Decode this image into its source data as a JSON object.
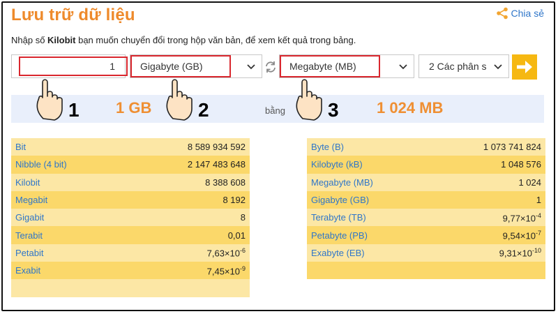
{
  "title": "Lưu trữ dữ liệu",
  "share_label": "Chia sẻ",
  "instruction": {
    "before": "Nhập số ",
    "bold": "Kilobit",
    "after": " bạn muốn chuyển đổi trong hộp văn bản, để xem kết quả trong bảng."
  },
  "input_value": "1",
  "from_unit": "Gigabyte (GB)",
  "to_unit": "Megabyte (MB)",
  "precision": "2 Các phân s",
  "result": {
    "from": "1 GB",
    "word": "bằng",
    "to": "1 024 MB"
  },
  "steps": [
    "1",
    "2",
    "3"
  ],
  "left_table": [
    {
      "unit": "Bit",
      "value": "8 589 934 592"
    },
    {
      "unit": "Nibble (4 bit)",
      "value": "2 147 483 648"
    },
    {
      "unit": "Kilobit",
      "value": "8 388 608"
    },
    {
      "unit": "Megabit",
      "value": "8 192"
    },
    {
      "unit": "Gigabit",
      "value": "8"
    },
    {
      "unit": "Terabit",
      "value": "0,01"
    },
    {
      "unit": "Petabit",
      "value": "7,63×10",
      "exp": "-6"
    },
    {
      "unit": "Exabit",
      "value": "7,45×10",
      "exp": "-9"
    },
    {
      "unit": "",
      "value": ""
    }
  ],
  "right_table": [
    {
      "unit": "Byte (B)",
      "value": "1 073 741 824"
    },
    {
      "unit": "Kilobyte (kB)",
      "value": "1 048 576"
    },
    {
      "unit": "Megabyte (MB)",
      "value": "1 024"
    },
    {
      "unit": "Gigabyte (GB)",
      "value": "1"
    },
    {
      "unit": "Terabyte (TB)",
      "value": "9,77×10",
      "exp": "-4"
    },
    {
      "unit": "Petabyte (PB)",
      "value": "9,54×10",
      "exp": "-7"
    },
    {
      "unit": "Exabyte (EB)",
      "value": "9,31×10",
      "exp": "-10"
    },
    {
      "unit": "",
      "value": ""
    }
  ],
  "colors": {
    "accent": "#ee8a2b",
    "link": "#2f76c9",
    "highlight": "#d9272e",
    "button": "#f6b812"
  }
}
